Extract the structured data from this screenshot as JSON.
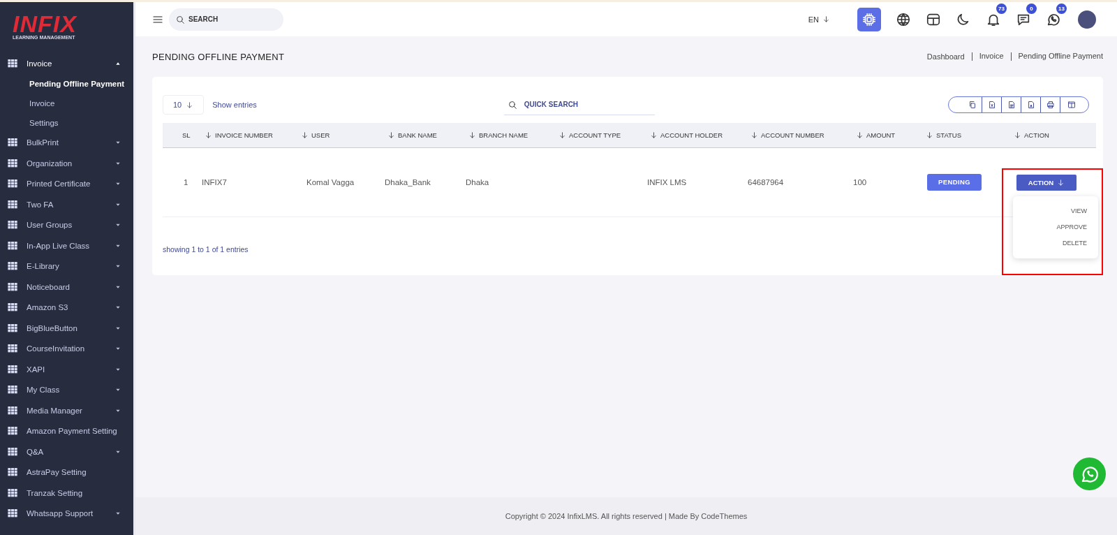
{
  "sidebar": {
    "logo": {
      "title": "INFIX",
      "subtitle": "LEARNING MANAGEMENT"
    },
    "items": [
      {
        "label": "Invoice",
        "kind": "group",
        "expanded": true,
        "children": [
          {
            "label": "Pending Offline Payment",
            "selected": true
          },
          {
            "label": "Invoice",
            "selected": false
          },
          {
            "label": "Settings",
            "selected": false
          }
        ]
      },
      {
        "label": "BulkPrint",
        "kind": "group",
        "expanded": false
      },
      {
        "label": "Organization",
        "kind": "group",
        "expanded": false
      },
      {
        "label": "Printed Certificate",
        "kind": "group",
        "expanded": false
      },
      {
        "label": "Two FA",
        "kind": "group",
        "expanded": false
      },
      {
        "label": "User Groups",
        "kind": "group",
        "expanded": false
      },
      {
        "label": "In-App Live Class",
        "kind": "group",
        "expanded": false
      },
      {
        "label": "E-Library",
        "kind": "group",
        "expanded": false
      },
      {
        "label": "Noticeboard",
        "kind": "group",
        "expanded": false
      },
      {
        "label": "Amazon S3",
        "kind": "group",
        "expanded": false
      },
      {
        "label": "BigBlueButton",
        "kind": "group",
        "expanded": false
      },
      {
        "label": "CourseInvitation",
        "kind": "group",
        "expanded": false
      },
      {
        "label": "XAPI",
        "kind": "group",
        "expanded": false
      },
      {
        "label": "My Class",
        "kind": "group",
        "expanded": false
      },
      {
        "label": "Media Manager",
        "kind": "group",
        "expanded": false
      },
      {
        "label": "Amazon Payment Setting",
        "kind": "link"
      },
      {
        "label": "Q&A",
        "kind": "group",
        "expanded": false
      },
      {
        "label": "AstraPay Setting",
        "kind": "link"
      },
      {
        "label": "Tranzak Setting",
        "kind": "link"
      },
      {
        "label": "Whatsapp Support",
        "kind": "group",
        "expanded": false
      }
    ]
  },
  "header": {
    "search": {
      "placeholder": "SEARCH"
    },
    "language": "EN",
    "icons": [
      {
        "kind": "chip",
        "active": true
      },
      {
        "kind": "globe",
        "active": false
      },
      {
        "kind": "layout",
        "active": false
      },
      {
        "kind": "moon",
        "active": false
      },
      {
        "kind": "bell",
        "active": false,
        "badge": "73"
      },
      {
        "kind": "chat",
        "active": false,
        "badge": "0"
      },
      {
        "kind": "whatsapp",
        "active": false,
        "badge": "13"
      }
    ]
  },
  "page": {
    "title": "PENDING OFFLINE PAYMENT",
    "breadcrumbs": [
      "Dashboard",
      "Invoice",
      "Pending Offline Payment"
    ]
  },
  "table": {
    "page_size": "10",
    "show_entries": "Show entries",
    "quick_search": {
      "placeholder": "QUICK SEARCH"
    },
    "export_buttons": [
      {
        "kind": "copy"
      },
      {
        "kind": "excel"
      },
      {
        "kind": "csv"
      },
      {
        "kind": "pdf"
      },
      {
        "kind": "print"
      },
      {
        "kind": "columns"
      }
    ],
    "columns": [
      {
        "label": "SL",
        "sortable": false
      },
      {
        "label": "INVOICE NUMBER",
        "sortable": true
      },
      {
        "label": "USER",
        "sortable": true
      },
      {
        "label": "BANK NAME",
        "sortable": true
      },
      {
        "label": "BRANCH NAME",
        "sortable": true
      },
      {
        "label": "ACCOUNT TYPE",
        "sortable": true
      },
      {
        "label": "ACCOUNT HOLDER",
        "sortable": true
      },
      {
        "label": "ACCOUNT NUMBER",
        "sortable": true
      },
      {
        "label": "AMOUNT",
        "sortable": true
      },
      {
        "label": "STATUS",
        "sortable": true
      },
      {
        "label": "ACTION",
        "sortable": true
      }
    ],
    "rows": [
      {
        "cells": [
          "1",
          "INFIX7",
          "Komal Vagga",
          "Dhaka_Bank",
          "Dhaka",
          "",
          "INFIX LMS",
          "64687964",
          "100"
        ],
        "status": "PENDING",
        "action": "ACTION"
      }
    ],
    "info": "showing 1 to 1 of 1 entries",
    "action_menu": {
      "items": [
        "VIEW",
        "APPROVE",
        "DELETE"
      ],
      "highlighted": true
    }
  },
  "footer": {
    "copyright": "Copyright © 2024 InfixLMS. All rights reserved | Made By CodeThemes"
  }
}
